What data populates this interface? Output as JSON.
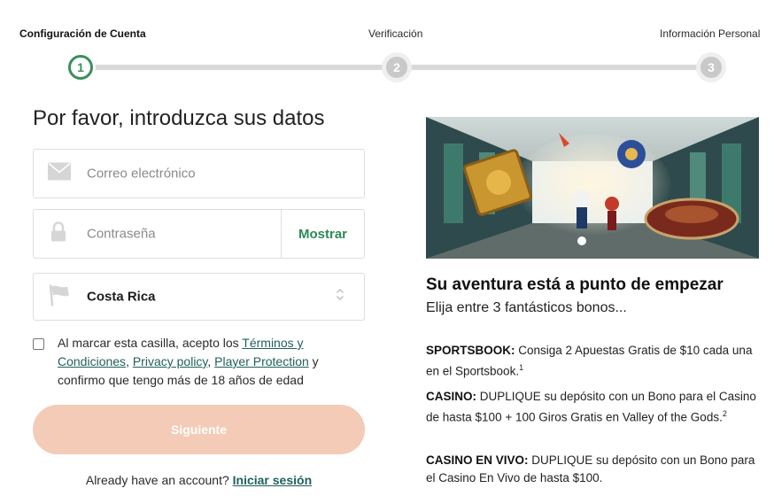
{
  "stepper": {
    "steps": [
      {
        "number": "1",
        "label": "Configuración de Cuenta"
      },
      {
        "number": "2",
        "label": "Verificación"
      },
      {
        "number": "3",
        "label": "Información Personal"
      }
    ]
  },
  "form": {
    "title": "Por favor, introduzca sus datos",
    "email_placeholder": "Correo electrónico",
    "password_placeholder": "Contraseña",
    "show_label": "Mostrar",
    "country_value": "Costa Rica",
    "consent_prefix": "Al marcar esta casilla, acepto los ",
    "terms_link": "Términos y Condiciones",
    "sep1": ", ",
    "privacy_link": "Privacy policy",
    "sep2": ", ",
    "protection_link": "Player Protection",
    "consent_suffix": " y confirmo que tengo más de 18 años de edad",
    "next_label": "Siguiente",
    "login_prompt": "Already have an account? ",
    "login_link": "Iniciar sesión"
  },
  "promo": {
    "title": "Su aventura está a punto de empezar",
    "subtitle": "Elija entre 3 fantásticos bonos...",
    "bonuses": [
      {
        "heading": "SPORTSBOOK:",
        "text": " Consiga 2 Apuestas Gratis de $10 cada una en el Sportsbook.",
        "sup": "1"
      },
      {
        "heading": "CASINO:",
        "text": " DUPLIQUE su depósito con un Bono para el Casino de hasta $100 + 100 Giros Gratis en Valley of the Gods.",
        "sup": "2"
      },
      {
        "heading": "CASINO EN VIVO:",
        "text": " DUPLIQUE su depósito con un Bono para el Casino En Vivo de hasta $100.",
        "sup": ""
      }
    ]
  },
  "colors": {
    "accent_green": "#3b8f5b",
    "button_disabled": "#f4cbb6",
    "link": "#1f5f5b"
  }
}
